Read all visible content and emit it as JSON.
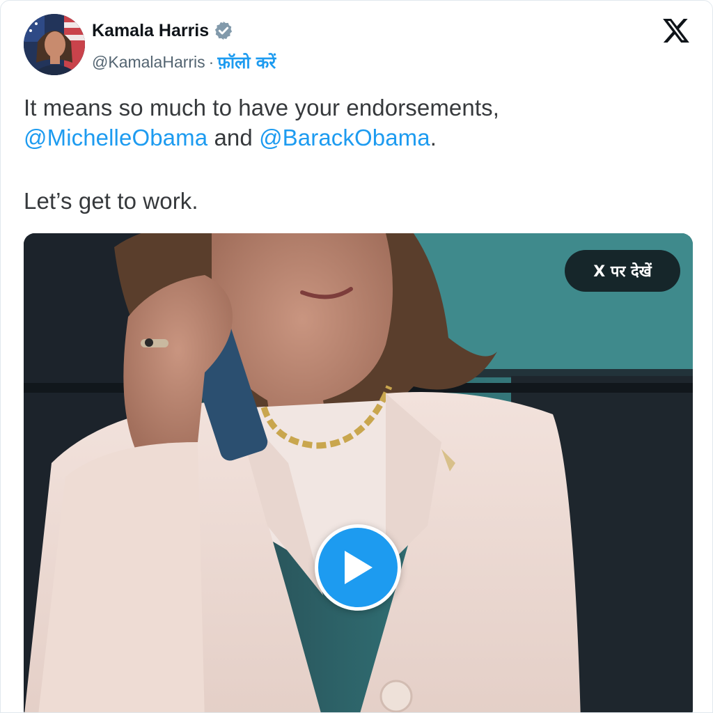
{
  "tweet": {
    "author_name": "Kamala Harris",
    "author_handle": "@KamalaHarris",
    "separator": "·",
    "follow_label": "फ़ॉलो करें",
    "text_line1": "It means so much to have your endorsements,",
    "mention1": "@MichelleObama",
    "connector": " and ",
    "mention2": "@BarackObama",
    "period": ".",
    "text_line3": "Let’s get to work."
  },
  "media": {
    "view_on_x_label": "X पर देखें"
  },
  "icons": {
    "verified": "verified-badge-icon",
    "platform": "x-logo-icon",
    "play": "play-icon"
  },
  "colors": {
    "link": "#1d9bf0",
    "text": "#36393c",
    "muted": "#536471"
  }
}
